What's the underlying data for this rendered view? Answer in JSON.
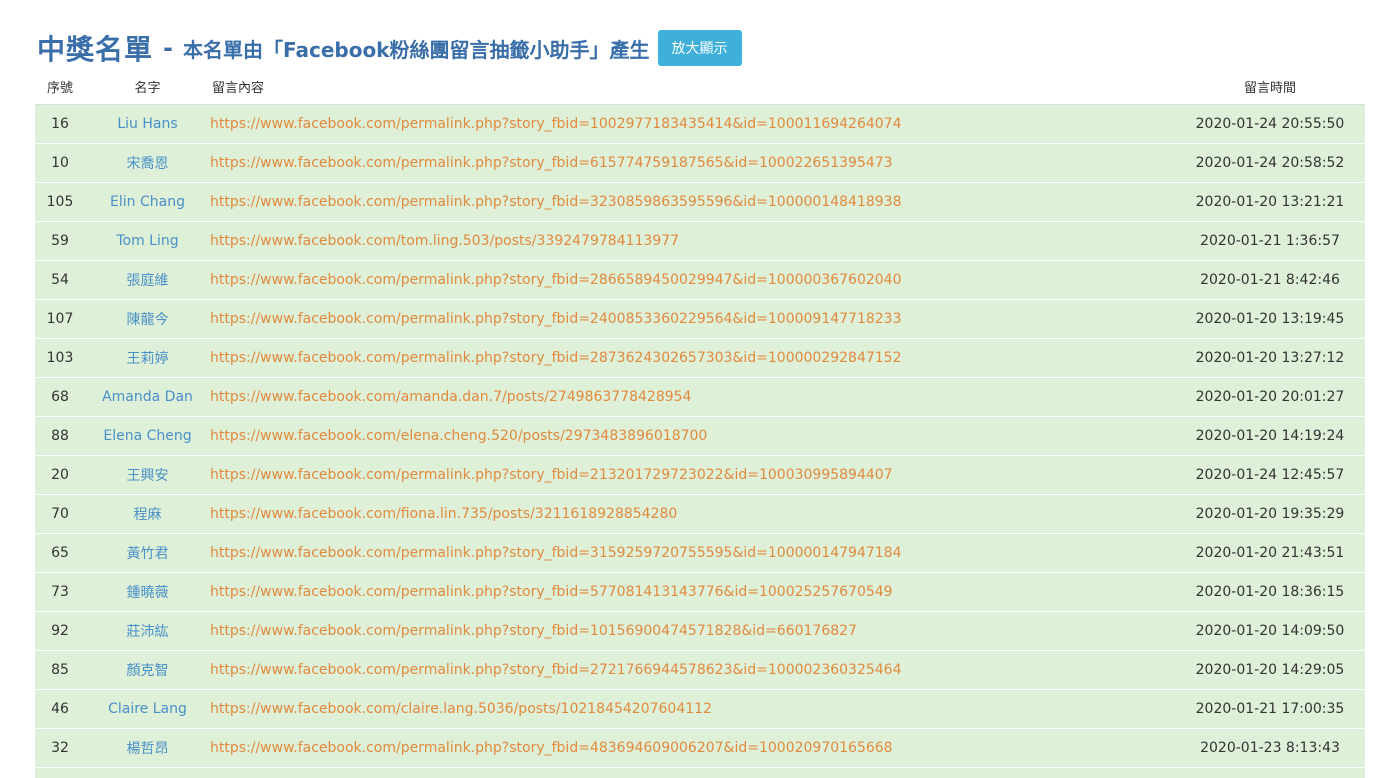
{
  "header": {
    "title": "中獎名單",
    "separator": "-",
    "subtitle": "本名單由「Facebook粉絲團留言抽籤小助手」產生",
    "zoom_button": "放大顯示"
  },
  "table": {
    "columns": {
      "no": "序號",
      "name": "名字",
      "content": "留言內容",
      "time": "留言時間"
    },
    "rows": [
      {
        "no": "16",
        "name": "Liu Hans",
        "link": "https://www.facebook.com/permalink.php?story_fbid=1002977183435414&id=100011694264074",
        "time": "2020-01-24 20:55:50"
      },
      {
        "no": "10",
        "name": "宋喬恩",
        "link": "https://www.facebook.com/permalink.php?story_fbid=615774759187565&id=100022651395473",
        "time": "2020-01-24 20:58:52"
      },
      {
        "no": "105",
        "name": "Elin Chang",
        "link": "https://www.facebook.com/permalink.php?story_fbid=3230859863595596&id=100000148418938",
        "time": "2020-01-20 13:21:21"
      },
      {
        "no": "59",
        "name": "Tom Ling",
        "link": "https://www.facebook.com/tom.ling.503/posts/3392479784113977",
        "time": "2020-01-21 1:36:57"
      },
      {
        "no": "54",
        "name": "張庭維",
        "link": "https://www.facebook.com/permalink.php?story_fbid=2866589450029947&id=100000367602040",
        "time": "2020-01-21 8:42:46"
      },
      {
        "no": "107",
        "name": "陳龍今",
        "link": "https://www.facebook.com/permalink.php?story_fbid=2400853360229564&id=100009147718233",
        "time": "2020-01-20 13:19:45"
      },
      {
        "no": "103",
        "name": "王莉婷",
        "link": "https://www.facebook.com/permalink.php?story_fbid=2873624302657303&id=100000292847152",
        "time": "2020-01-20 13:27:12"
      },
      {
        "no": "68",
        "name": "Amanda Dan",
        "link": "https://www.facebook.com/amanda.dan.7/posts/2749863778428954",
        "time": "2020-01-20 20:01:27"
      },
      {
        "no": "88",
        "name": "Elena Cheng",
        "link": "https://www.facebook.com/elena.cheng.520/posts/2973483896018700",
        "time": "2020-01-20 14:19:24"
      },
      {
        "no": "20",
        "name": "王興安",
        "link": "https://www.facebook.com/permalink.php?story_fbid=213201729723022&id=100030995894407",
        "time": "2020-01-24 12:45:57"
      },
      {
        "no": "70",
        "name": "程麻",
        "link": "https://www.facebook.com/fiona.lin.735/posts/3211618928854280",
        "time": "2020-01-20 19:35:29"
      },
      {
        "no": "65",
        "name": "黃竹君",
        "link": "https://www.facebook.com/permalink.php?story_fbid=3159259720755595&id=100000147947184",
        "time": "2020-01-20 21:43:51"
      },
      {
        "no": "73",
        "name": "鍾曉薇",
        "link": "https://www.facebook.com/permalink.php?story_fbid=577081413143776&id=100025257670549",
        "time": "2020-01-20 18:36:15"
      },
      {
        "no": "92",
        "name": "莊沛紘",
        "link": "https://www.facebook.com/permalink.php?story_fbid=10156900474571828&id=660176827",
        "time": "2020-01-20 14:09:50"
      },
      {
        "no": "85",
        "name": "顏克智",
        "link": "https://www.facebook.com/permalink.php?story_fbid=2721766944578623&id=100002360325464",
        "time": "2020-01-20 14:29:05"
      },
      {
        "no": "46",
        "name": "Claire Lang",
        "link": "https://www.facebook.com/claire.lang.5036/posts/10218454207604112",
        "time": "2020-01-21 17:00:35"
      },
      {
        "no": "32",
        "name": "楊哲昂",
        "link": "https://www.facebook.com/permalink.php?story_fbid=483694609006207&id=100020970165668",
        "time": "2020-01-23 8:13:43"
      },
      {
        "no": "",
        "name": "",
        "link": "",
        "time": ""
      }
    ]
  }
}
